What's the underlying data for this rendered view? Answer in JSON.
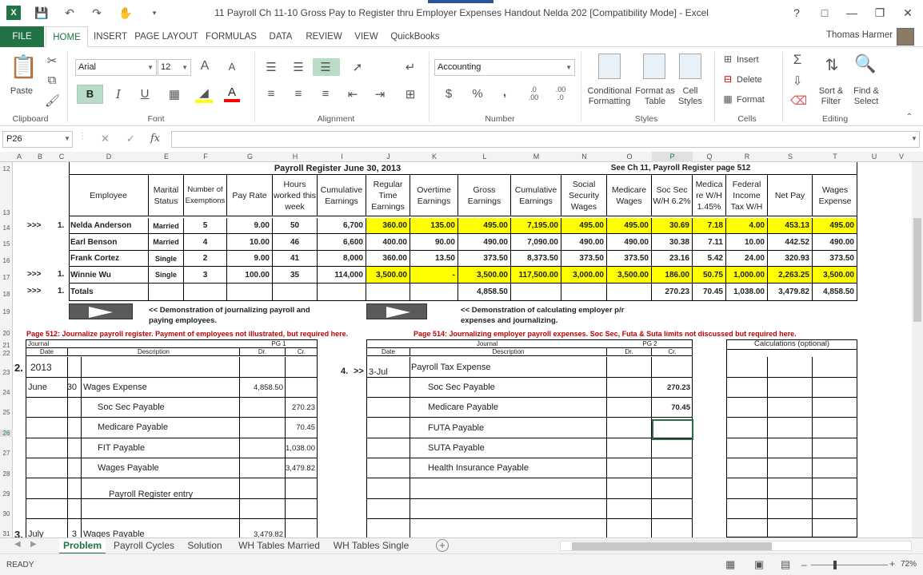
{
  "window": {
    "title": "11 Payroll Ch 11-10 Gross Pay to  Register thru Employer Expenses Handout Nelda 202  [Compatibility Mode] - Excel",
    "user": "Thomas Harmer"
  },
  "ribbon_tabs": [
    "FILE",
    "HOME",
    "INSERT",
    "PAGE LAYOUT",
    "FORMULAS",
    "DATA",
    "REVIEW",
    "VIEW",
    "QuickBooks"
  ],
  "ribbon": {
    "clipboard": {
      "paste": "Paste",
      "label": "Clipboard"
    },
    "font": {
      "name": "Arial",
      "size": "12",
      "label": "Font",
      "bold": "B",
      "italic": "I",
      "underline": "U"
    },
    "alignment": {
      "label": "Alignment"
    },
    "number": {
      "format": "Accounting",
      "label": "Number",
      "currency": "$",
      "percent": "%",
      "comma": ","
    },
    "styles": {
      "conditional": "Conditional Formatting",
      "format_table": "Format as Table",
      "cell_styles": "Cell Styles",
      "label": "Styles"
    },
    "cells": {
      "insert": "Insert",
      "delete": "Delete",
      "format": "Format",
      "label": "Cells"
    },
    "editing": {
      "sort": "Sort & Filter",
      "find": "Find & Select",
      "label": "Editing"
    }
  },
  "formula_bar": {
    "name_box": "P26",
    "formula": "",
    "fx": "fx"
  },
  "columns": [
    "A",
    "B",
    "C",
    "D",
    "E",
    "F",
    "G",
    "H",
    "I",
    "J",
    "K",
    "L",
    "M",
    "N",
    "O",
    "P",
    "Q",
    "R",
    "S",
    "T",
    "U",
    "V"
  ],
  "rows": [
    "12",
    "13",
    "14",
    "15",
    "16",
    "17",
    "18",
    "19",
    "20",
    "21",
    "22",
    "23",
    "24",
    "25",
    "26",
    "27",
    "28",
    "29",
    "30",
    "31"
  ],
  "register": {
    "title": "Payroll Register June 30, 2013",
    "see_note": "See Ch 11, Payroll Register page 512",
    "headers": [
      "Employee",
      "Marital Status",
      "Number of Exemptions",
      "Pay Rate",
      "Hours worked this week",
      "Cumulative Earnings",
      "Regular Time Earnings",
      "Overtime Earnings",
      "Gross Earnings",
      "Cumulative Earnings",
      "Social Security Wages",
      "Medicare Wages",
      "Soc Sec W/H 6.2%",
      "Medica re W/H 1.45%",
      "Federal Income Tax W/H",
      "Net Pay",
      "Wages Expense"
    ],
    "rows": [
      {
        "marker": ">>>",
        "num": "1.",
        "name": "Nelda Anderson",
        "status": "Married",
        "ex": "5",
        "rate": "9.00",
        "hours": "50",
        "cum": "6,700",
        "reg": "360.00",
        "ot": "135.00",
        "gross": "495.00",
        "cum2": "7,195.00",
        "ssw": "495.00",
        "medw": "495.00",
        "ss": "30.69",
        "med": "7.18",
        "fit": "4.00",
        "net": "453.13",
        "wexp": "495.00",
        "hl": true
      },
      {
        "marker": "",
        "num": "",
        "name": "Earl Benson",
        "status": "Married",
        "ex": "4",
        "rate": "10.00",
        "hours": "46",
        "cum": "6,600",
        "reg": "400.00",
        "ot": "90.00",
        "gross": "490.00",
        "cum2": "7,090.00",
        "ssw": "490.00",
        "medw": "490.00",
        "ss": "30.38",
        "med": "7.11",
        "fit": "10.00",
        "net": "442.52",
        "wexp": "490.00",
        "hl": false
      },
      {
        "marker": "",
        "num": "",
        "name": "Frank Cortez",
        "status": "Single",
        "ex": "2",
        "rate": "9.00",
        "hours": "41",
        "cum": "8,000",
        "reg": "360.00",
        "ot": "13.50",
        "gross": "373.50",
        "cum2": "8,373.50",
        "ssw": "373.50",
        "medw": "373.50",
        "ss": "23.16",
        "med": "5.42",
        "fit": "24.00",
        "net": "320.93",
        "wexp": "373.50",
        "hl": false
      },
      {
        "marker": ">>>",
        "num": "1.",
        "name": "Winnie Wu",
        "status": "Single",
        "ex": "3",
        "rate": "100.00",
        "hours": "35",
        "cum": "114,000",
        "reg": "3,500.00",
        "ot": "-",
        "gross": "3,500.00",
        "cum2": "117,500.00",
        "ssw": "3,000.00",
        "medw": "3,500.00",
        "ss": "186.00",
        "med": "50.75",
        "fit": "1,000.00",
        "net": "2,263.25",
        "wexp": "3,500.00",
        "hl": true
      }
    ],
    "totals": {
      "marker": ">>>",
      "num": "1.",
      "label": "Totals",
      "gross": "4,858.50",
      "ss": "270.23",
      "med": "70.45",
      "fit": "1,038.00",
      "net": "3,479.82",
      "wexp": "4,858.50"
    }
  },
  "demo": {
    "left": "<< Demonstration of journalizing payroll and paying employees.",
    "right": "<< Demonstration of calculating employer p/r expenses and journalizing."
  },
  "notes": {
    "left": "Page 512: Journalize payroll register.  Payment of employees not illustrated, but required here.",
    "right": "Page 514:  Journalizing employer payroll expenses.  Soc Sec, Futa & Suta limits not discussed but required here."
  },
  "journal1": {
    "title": "Journal",
    "pg": "PG 1",
    "date": "Date",
    "desc": "Description",
    "dr": "Dr.",
    "cr": "Cr.",
    "step": "2.",
    "year": "2013",
    "entries": [
      {
        "month": "June",
        "day": "30",
        "desc": "Wages Expense",
        "dr": "4,858.50",
        "cr": ""
      },
      {
        "month": "",
        "day": "",
        "desc": "Soc Sec Payable",
        "dr": "",
        "cr": "270.23"
      },
      {
        "month": "",
        "day": "",
        "desc": "Medicare Payable",
        "dr": "",
        "cr": "70.45"
      },
      {
        "month": "",
        "day": "",
        "desc": "FIT Payable",
        "dr": "",
        "cr": "1,038.00"
      },
      {
        "month": "",
        "day": "",
        "desc": "Wages Payable",
        "dr": "",
        "cr": "3,479.82"
      }
    ],
    "memo": "Payroll Register entry",
    "last": {
      "step": "3.",
      "month": "July",
      "day": "3",
      "desc": "Wages Payable",
      "dr": "3,479.82"
    }
  },
  "journal2": {
    "title": "Journal",
    "pg": "PG 2",
    "date": "Date",
    "desc": "Description",
    "dr": "Dr.",
    "cr": "Cr.",
    "step": "4.",
    "marker": ">>",
    "date_val": "3-Jul",
    "entries": [
      {
        "desc": "Payroll Tax Expense",
        "cr": ""
      },
      {
        "desc": "Soc Sec Payable",
        "cr": "270.23"
      },
      {
        "desc": "Medicare Payable",
        "cr": "70.45"
      },
      {
        "desc": "FUTA Payable",
        "cr": ""
      },
      {
        "desc": "SUTA Payable",
        "cr": ""
      },
      {
        "desc": "Health Insurance Payable",
        "cr": ""
      }
    ]
  },
  "calc": {
    "title": "Calculations (optional)"
  },
  "sheet_tabs": [
    "Problem",
    "Payroll Cycles",
    "Solution",
    "WH Tables Married",
    "WH Tables Single"
  ],
  "status": {
    "ready": "READY",
    "zoom": "72%"
  }
}
